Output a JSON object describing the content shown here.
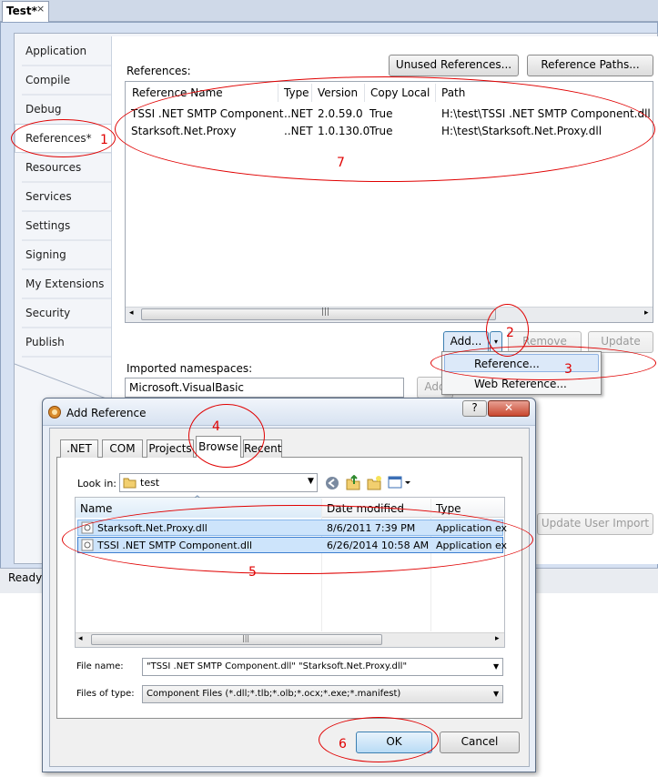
{
  "doc_tab": {
    "title": "Test*",
    "close_glyph": "×"
  },
  "nav": {
    "items": [
      "Application",
      "Compile",
      "Debug",
      "References*",
      "Resources",
      "Services",
      "Settings",
      "Signing",
      "My Extensions",
      "Security",
      "Publish"
    ],
    "selected_index": 3
  },
  "references": {
    "label": "References:",
    "unused_button": "Unused References...",
    "paths_button": "Reference Paths...",
    "columns": [
      "Reference Name",
      "Type",
      "Version",
      "Copy Local",
      "Path"
    ],
    "rows": [
      [
        "TSSI .NET SMTP Component",
        "..NET",
        "2.0.59.0",
        "True",
        "H:\\test\\TSSI .NET SMTP Component.dll"
      ],
      [
        "Starksoft.Net.Proxy",
        "..NET",
        "1.0.130.0",
        "True",
        "H:\\test\\Starksoft.Net.Proxy.dll"
      ]
    ],
    "add_button": "Add...",
    "remove_button": "Remove",
    "update_button": "Update"
  },
  "add_menu": {
    "items": [
      "Reference...",
      "Web Reference..."
    ]
  },
  "imports": {
    "label": "Imported namespaces:",
    "value": "Microsoft.VisualBasic",
    "add_button_partial": "Add"
  },
  "update_user_import": "Update User Import",
  "status": {
    "text": "Ready"
  },
  "dialog": {
    "title": "Add Reference",
    "tabs": [
      ".NET",
      "COM",
      "Projects",
      "Browse",
      "Recent"
    ],
    "selected_tab": 3,
    "look_in_label": "Look in:",
    "look_in_value": "test",
    "columns": [
      "Name",
      "Date modified",
      "Type"
    ],
    "files": [
      {
        "name": "Starksoft.Net.Proxy.dll",
        "date": "8/6/2011 7:39 PM",
        "type": "Application ex"
      },
      {
        "name": "TSSI .NET SMTP Component.dll",
        "date": "6/26/2014 10:58 AM",
        "type": "Application ex"
      }
    ],
    "file_name_label": "File name:",
    "file_name_value": "\"TSSI .NET SMTP Component.dll\" \"Starksoft.Net.Proxy.dll\"",
    "files_of_type_label": "Files of type:",
    "files_of_type_value": "Component Files (*.dll;*.tlb;*.olb;*.ocx;*.exe;*.manifest)",
    "ok_button": "OK",
    "cancel_button": "Cancel",
    "help_glyph": "?",
    "close_glyph": "✕"
  },
  "annotations": [
    "1",
    "2",
    "3",
    "4",
    "5",
    "6",
    "7"
  ],
  "colors": {
    "annotation": "#e00000",
    "selection": "#cde4fb",
    "window_frame": "#d6e1f2"
  }
}
